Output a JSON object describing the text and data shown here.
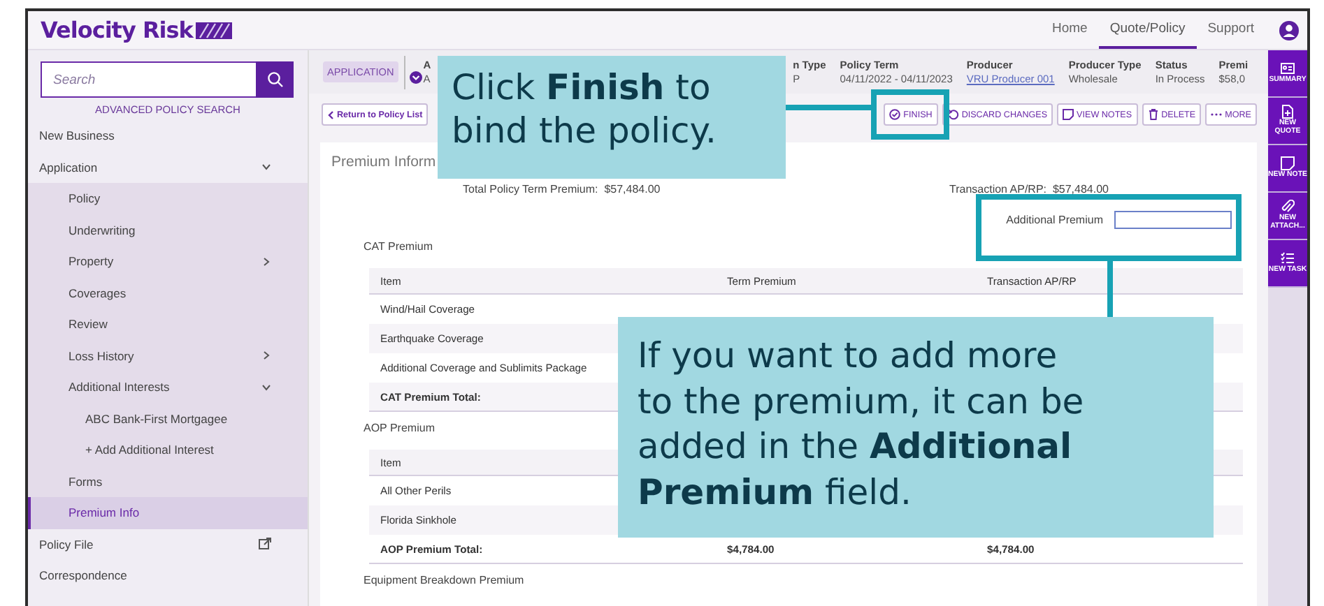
{
  "brand": {
    "name": "Velocity Risk"
  },
  "top_nav": [
    {
      "label": "Home",
      "selected": false
    },
    {
      "label": "Quote/Policy",
      "selected": true
    },
    {
      "label": "Support",
      "selected": false
    }
  ],
  "sidebar": {
    "search": {
      "placeholder": "Search"
    },
    "advanced_link": "ADVANCED POLICY SEARCH",
    "items": [
      {
        "label": "New Business",
        "kind": "link",
        "selected": false
      },
      {
        "label": "Application",
        "kind": "group",
        "expanded": true,
        "selected": false,
        "children": [
          {
            "label": "Policy",
            "kind": "link",
            "selected": false
          },
          {
            "label": "Underwriting",
            "kind": "link",
            "selected": false
          },
          {
            "label": "Property",
            "kind": "group",
            "expanded": false,
            "selected": false
          },
          {
            "label": "Coverages",
            "kind": "link",
            "selected": false
          },
          {
            "label": "Review",
            "kind": "link",
            "selected": false
          },
          {
            "label": "Loss History",
            "kind": "group",
            "expanded": false,
            "selected": false
          },
          {
            "label": "Additional Interests",
            "kind": "group",
            "expanded": true,
            "selected": false,
            "children": [
              {
                "label": "ABC Bank-First Mortgagee",
                "kind": "link",
                "selected": false
              },
              {
                "label": "+ Add Additional Interest",
                "kind": "link",
                "selected": false
              }
            ]
          },
          {
            "label": "Forms",
            "kind": "link",
            "selected": false
          },
          {
            "label": "Premium Info",
            "kind": "link",
            "selected": true
          }
        ]
      },
      {
        "label": "Policy File",
        "kind": "external",
        "selected": false
      },
      {
        "label": "Correspondence",
        "kind": "link",
        "selected": false
      }
    ]
  },
  "header": {
    "status": "APPLICATION",
    "fields_left": [
      {
        "label": "A",
        "value": "A"
      }
    ],
    "fields": [
      {
        "label": "n Type",
        "value": "P",
        "link": false
      },
      {
        "label": "Policy Term",
        "value": "04/11/2022 - 04/11/2023",
        "link": false
      },
      {
        "label": "Producer",
        "value": "VRU Producer 001",
        "link": true
      },
      {
        "label": "Producer Type",
        "value": "Wholesale",
        "link": false
      },
      {
        "label": "Status",
        "value": "In Process",
        "link": false
      },
      {
        "label": "Premi",
        "value": "$58,0",
        "link": false
      }
    ]
  },
  "back_button": "Return to Policy List",
  "actions": [
    {
      "label": "FINISH",
      "kind": "finish"
    },
    {
      "label": "DISCARD CHANGES",
      "kind": "discard"
    },
    {
      "label": "VIEW NOTES",
      "kind": "notes"
    },
    {
      "label": "DELETE",
      "kind": "delete"
    },
    {
      "label": "MORE",
      "kind": "more"
    }
  ],
  "rail": [
    {
      "label": "SUMMARY",
      "kind": "summary"
    },
    {
      "label": "NEW QUOTE",
      "kind": "quote"
    },
    {
      "label": "NEW NOTE",
      "kind": "note"
    },
    {
      "label": "NEW ATTACH...",
      "kind": "attach"
    },
    {
      "label": "NEW TASK",
      "kind": "task"
    }
  ],
  "content": {
    "title": "Premium Inform",
    "total_term": {
      "label": "Total Policy Term Premium:",
      "value": "$57,484.00"
    },
    "transaction": {
      "label": "Transaction AP/RP:",
      "value": "$57,484.00"
    },
    "additional_premium": {
      "label": "Additional Premium"
    },
    "sections": [
      {
        "title": "CAT Premium",
        "columns": [
          "Item",
          "Term Premium",
          "Transaction AP/RP"
        ],
        "rows": [
          {
            "item": "Wind/Hail Coverage",
            "total": false
          },
          {
            "item": "Earthquake Coverage",
            "total": false
          },
          {
            "item": "Additional Coverage and Sublimits Package",
            "total": false
          },
          {
            "item": "CAT Premium Total:",
            "total": true
          }
        ]
      },
      {
        "title": "AOP Premium",
        "columns": [
          "Item"
        ],
        "rows": [
          {
            "item": "All Other Perils",
            "total": false
          },
          {
            "item": "Florida Sinkhole",
            "total": false
          },
          {
            "item": "AOP Premium Total:",
            "term": "$4,784.00",
            "transaction": "$4,784.00",
            "total": true
          }
        ]
      },
      {
        "title": "Equipment Breakdown Premium"
      }
    ]
  },
  "callouts": [
    {
      "text": "Click **Finish** to bind the policy."
    },
    {
      "text": "If you want to add more to the premium, it can be added in the **Additional Premium** field."
    }
  ]
}
